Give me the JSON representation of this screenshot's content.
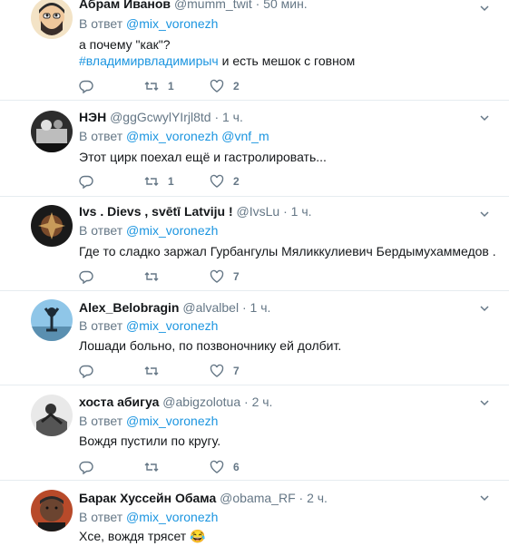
{
  "tweets": [
    {
      "name": "Абрам Иванов",
      "handle": "@mumm_twit",
      "time": "50 мин.",
      "reply_prefix": "В ответ",
      "mentions": [
        "@mix_voronezh"
      ],
      "lines": [
        "а почему \"как\"?"
      ],
      "hashtag": "#владимирвладимирыч",
      "hashtag_rest": " и есть мешок с говном",
      "retweets": "1",
      "likes": "2"
    },
    {
      "name": "НЭН",
      "handle": "@ggGcwylYIrjl8td",
      "time": "1 ч.",
      "reply_prefix": "В ответ",
      "mentions": [
        "@mix_voronezh",
        "@vnf_m"
      ],
      "lines": [
        "Этот цирк поехал ещё и  гастролировать..."
      ],
      "retweets": "1",
      "likes": "2"
    },
    {
      "name": "Ivs . Dievs , svētī Latviju !",
      "handle": "@IvsLu",
      "time": "1 ч.",
      "reply_prefix": "В ответ",
      "mentions": [
        "@mix_voronezh"
      ],
      "lines": [
        "Где то сладко заржал Гурбангулы Мяликкулиевич Бердымухаммедов ."
      ],
      "retweets": "",
      "likes": "7"
    },
    {
      "name": "Alex_Belobragin",
      "handle": "@alvalbel",
      "time": "1 ч.",
      "reply_prefix": "В ответ",
      "mentions": [
        "@mix_voronezh"
      ],
      "lines": [
        "Лошади больно, по позвоночнику ей долбит."
      ],
      "retweets": "",
      "likes": "7"
    },
    {
      "name": "хоста абигуа",
      "handle": "@abigzolotua",
      "time": "2 ч.",
      "reply_prefix": "В ответ",
      "mentions": [
        "@mix_voronezh"
      ],
      "lines": [
        "Вождя пустили по кругу."
      ],
      "retweets": "",
      "likes": "6"
    },
    {
      "name": "Барак Хуссейн Обама",
      "handle": "@obama_RF",
      "time": "2 ч.",
      "reply_prefix": "В ответ",
      "mentions": [
        "@mix_voronezh"
      ],
      "lines": [
        "Х",
        "се, вождя трясет 😂"
      ],
      "retweets": "",
      "likes": ""
    }
  ],
  "icons": {
    "reply": "reply-icon",
    "retweet": "retweet-icon",
    "like": "heart-icon",
    "more": "chevron-down-icon"
  },
  "colors": {
    "link": "#1b95e0",
    "secondary": "#657786",
    "divider": "#e6ecf0"
  }
}
